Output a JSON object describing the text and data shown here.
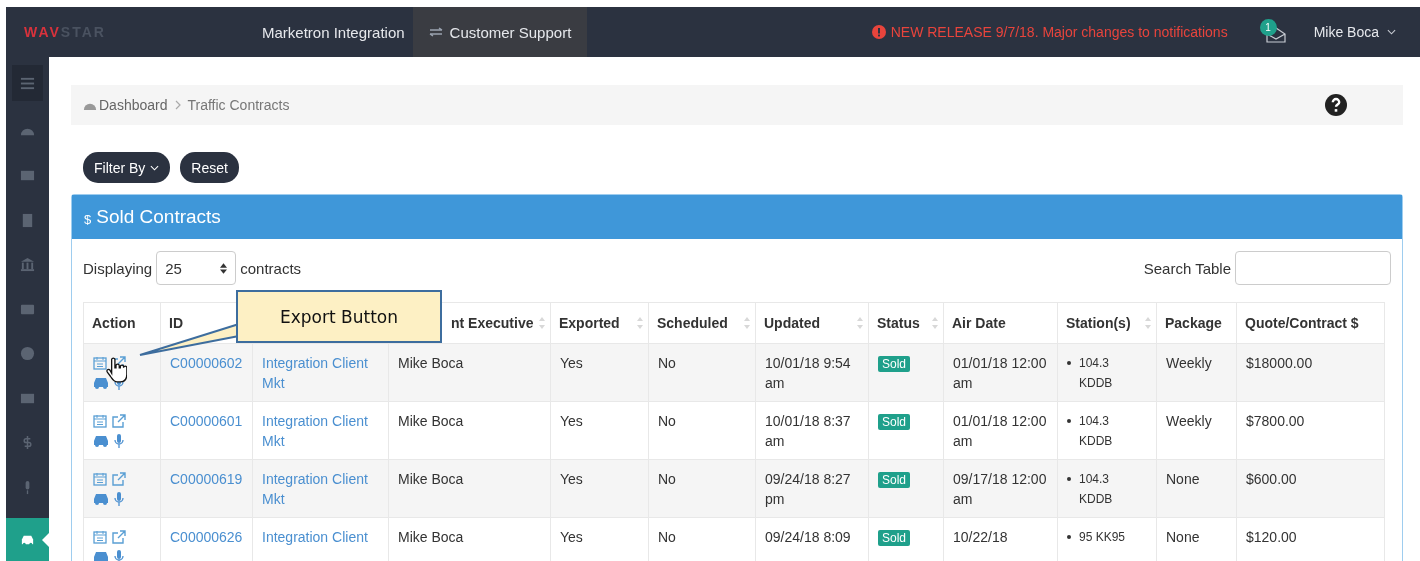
{
  "brand": {
    "accent": "WAV",
    "rest": "STAR"
  },
  "nav": [
    {
      "label": "Marketron Integration",
      "selected": false
    },
    {
      "label": "Customer Support",
      "selected": true
    }
  ],
  "alert": "NEW RELEASE 9/7/18. Major changes to notifications",
  "notifications": {
    "count": "1"
  },
  "user": "Mike Boca",
  "sidebar": {
    "items": [
      {
        "selected": false
      },
      {
        "selected": false
      },
      {
        "selected": false
      },
      {
        "selected": false
      },
      {
        "selected": false
      },
      {
        "selected": false
      },
      {
        "selected": false
      },
      {
        "selected": false
      },
      {
        "selected": false
      },
      {
        "selected": false
      },
      {
        "selected": true
      }
    ]
  },
  "breadcrumb": [
    "Dashboard",
    "Traffic Contracts"
  ],
  "buttons": [
    {
      "label": "Filter By",
      "kind": "dropdown"
    },
    {
      "label": "Reset",
      "kind": "plain"
    }
  ],
  "panel": {
    "icon": "$",
    "title": "Sold Contracts"
  },
  "length": {
    "label": "Displaying",
    "value": "25",
    "suffix": "contracts"
  },
  "search": {
    "label": "Search Table"
  },
  "callout": {
    "text": "Export Button"
  },
  "table": {
    "columns": [
      {
        "label": "Action",
        "sortable": false
      },
      {
        "label": "ID"
      },
      {},
      {
        "label": "nt Executive",
        "sortable": true
      },
      {
        "label": "Exported",
        "sortable": true
      },
      {
        "label": "Scheduled",
        "sortable": true
      },
      {
        "label": "Updated",
        "sortable": true
      },
      {
        "label": "Status",
        "sortable": true
      },
      {
        "label": "Air Date",
        "sortable": false
      },
      {
        "label": "Station(s)",
        "sortable": true
      },
      {
        "label": "Package",
        "sortable": false
      },
      {
        "label": "Quote/Contract $",
        "sortable": false
      }
    ],
    "rows": [
      {
        "id": "C00000602",
        "client": "Integration Client Mkt",
        "executive": "Mike Boca",
        "exported": "Yes",
        "scheduled": "No",
        "updated": "10/01/18 9:54 am",
        "status": "Sold",
        "air_date": "01/01/18 12:00 am",
        "stations": [
          "104.3 KDDB"
        ],
        "package": "Weekly",
        "amount": "$18000.00"
      },
      {
        "id": "C00000601",
        "client": "Integration Client Mkt",
        "executive": "Mike Boca",
        "exported": "Yes",
        "scheduled": "No",
        "updated": "10/01/18 8:37 am",
        "status": "Sold",
        "air_date": "01/01/18 12:00 am",
        "stations": [
          "104.3 KDDB"
        ],
        "package": "Weekly",
        "amount": "$7800.00"
      },
      {
        "id": "C00000619",
        "client": "Integration Client Mkt",
        "executive": "Mike Boca",
        "exported": "Yes",
        "scheduled": "No",
        "updated": "09/24/18 8:27 pm",
        "status": "Sold",
        "air_date": "09/17/18 12:00 am",
        "stations": [
          "104.3 KDDB"
        ],
        "package": "None",
        "amount": "$600.00"
      },
      {
        "id": "C00000626",
        "client": "Integration Client",
        "executive": "Mike Boca",
        "exported": "Yes",
        "scheduled": "No",
        "updated": "09/24/18 8:09",
        "status": "Sold",
        "air_date": "10/22/18",
        "stations": [
          "95 KK95"
        ],
        "package": "None",
        "amount": "$120.00"
      }
    ]
  }
}
